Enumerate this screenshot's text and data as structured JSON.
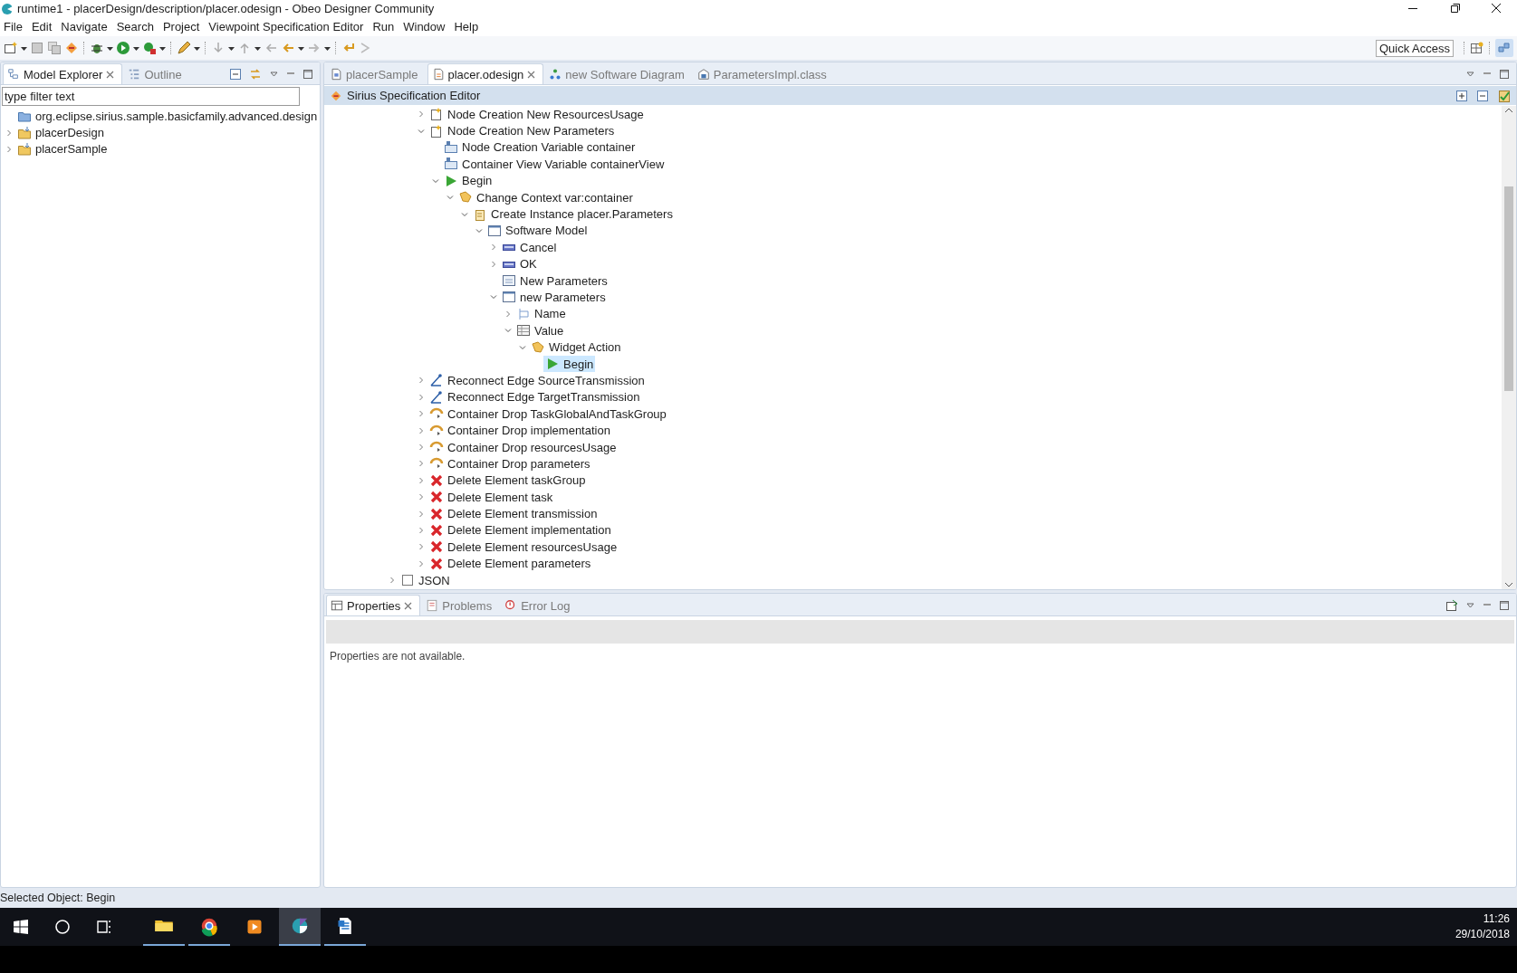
{
  "window": {
    "title": "runtime1 - placerDesign/description/placer.odesign - Obeo Designer Community"
  },
  "menu": [
    "File",
    "Edit",
    "Navigate",
    "Search",
    "Project",
    "Viewpoint Specification Editor",
    "Run",
    "Window",
    "Help"
  ],
  "toolbar": {
    "quick_access": "Quick Access"
  },
  "explorer": {
    "tabs": [
      {
        "label": "Model Explorer",
        "kind": "explorer",
        "selected": true
      },
      {
        "label": "Outline",
        "kind": "outline",
        "selected": false
      }
    ],
    "filter": {
      "placeholder": "type filter text"
    },
    "items": [
      {
        "label": "org.eclipse.sirius.sample.basicfamily.advanced.design",
        "kind": "folder",
        "selected": false
      },
      {
        "label": "placerDesign",
        "kind": "project",
        "expanded": false,
        "selected": false
      },
      {
        "label": "placerSample",
        "kind": "project",
        "expanded": false,
        "selected": false
      }
    ]
  },
  "editor": {
    "tabs": [
      {
        "label": "placerSample",
        "kind": "diagram",
        "selected": false
      },
      {
        "label": "placer.odesign",
        "kind": "odesign",
        "selected": true
      },
      {
        "label": "new Software Diagram",
        "kind": "tree-diagram",
        "selected": false
      },
      {
        "label": "ParametersImpl.class",
        "kind": "class",
        "selected": false
      }
    ],
    "header": "Sirius Specification Editor",
    "tree": {
      "items": [
        {
          "label": "Node Creation New ResourcesUsage",
          "kind": "node-creation",
          "expanded": false,
          "selected": false
        },
        {
          "label": "Node Creation New Parameters",
          "kind": "node-creation",
          "expanded": true,
          "selected": false,
          "children": [
            {
              "label": "Node Creation Variable container",
              "kind": "variable",
              "selected": false
            },
            {
              "label": "Container View Variable containerView",
              "kind": "variable",
              "selected": false
            },
            {
              "label": "Begin",
              "kind": "begin",
              "expanded": true,
              "selected": false,
              "children": [
                {
                  "label": "Change Context var:container",
                  "kind": "change-context",
                  "expanded": true,
                  "selected": false,
                  "children": [
                    {
                      "label": "Create Instance placer.Parameters",
                      "kind": "create-instance",
                      "expanded": true,
                      "selected": false,
                      "children": [
                        {
                          "label": "Software Model",
                          "kind": "page",
                          "expanded": true,
                          "selected": false,
                          "children": [
                            {
                              "label": "Cancel",
                              "kind": "button",
                              "expanded": false,
                              "selected": false
                            },
                            {
                              "label": "OK",
                              "kind": "button",
                              "expanded": false,
                              "selected": false
                            },
                            {
                              "label": "New Parameters",
                              "kind": "form",
                              "selected": false
                            },
                            {
                              "label": "new Parameters",
                              "kind": "page",
                              "expanded": true,
                              "selected": false,
                              "children": [
                                {
                                  "label": "Name",
                                  "kind": "label",
                                  "expanded": false,
                                  "selected": false
                                },
                                {
                                  "label": "Value",
                                  "kind": "table",
                                  "expanded": true,
                                  "selected": false,
                                  "children": [
                                    {
                                      "label": "Widget Action",
                                      "kind": "change-context",
                                      "expanded": true,
                                      "selected": false,
                                      "children": [
                                        {
                                          "label": "Begin",
                                          "kind": "begin",
                                          "selected": true
                                        }
                                      ]
                                    }
                                  ]
                                }
                              ]
                            }
                          ]
                        }
                      ]
                    }
                  ]
                }
              ]
            }
          ]
        },
        {
          "label": "Reconnect Edge SourceTransmission",
          "kind": "reconnect",
          "expanded": false,
          "selected": false
        },
        {
          "label": "Reconnect Edge TargetTransmission",
          "kind": "reconnect",
          "expanded": false,
          "selected": false
        },
        {
          "label": "Container Drop TaskGlobalAndTaskGroup",
          "kind": "drop",
          "expanded": false,
          "selected": false
        },
        {
          "label": "Container Drop implementation",
          "kind": "drop",
          "expanded": false,
          "selected": false
        },
        {
          "label": "Container Drop resourcesUsage",
          "kind": "drop",
          "expanded": false,
          "selected": false
        },
        {
          "label": "Container Drop parameters",
          "kind": "drop",
          "expanded": false,
          "selected": false
        },
        {
          "label": "Delete Element taskGroup",
          "kind": "delete",
          "expanded": false,
          "selected": false
        },
        {
          "label": "Delete Element task",
          "kind": "delete",
          "expanded": false,
          "selected": false
        },
        {
          "label": "Delete Element transmission",
          "kind": "delete",
          "expanded": false,
          "selected": false
        },
        {
          "label": "Delete Element implementation",
          "kind": "delete",
          "expanded": false,
          "selected": false
        },
        {
          "label": "Delete Element resourcesUsage",
          "kind": "delete",
          "expanded": false,
          "selected": false
        },
        {
          "label": "Delete Element parameters",
          "kind": "delete",
          "expanded": false,
          "selected": false
        }
      ],
      "outer_items": [
        {
          "label": "JSON",
          "kind": "group",
          "expanded": false,
          "selected": false
        }
      ]
    }
  },
  "properties": {
    "tabs": [
      {
        "label": "Properties",
        "kind": "properties",
        "selected": true
      },
      {
        "label": "Problems",
        "kind": "problems",
        "selected": false
      },
      {
        "label": "Error Log",
        "kind": "error-log",
        "selected": false
      }
    ],
    "message": "Properties are not available."
  },
  "status_bar": "Selected Object: Begin",
  "taskbar": {
    "apps": [
      {
        "kind": "files",
        "running": true,
        "active": false
      },
      {
        "kind": "browser",
        "running": true,
        "active": false
      },
      {
        "kind": "media",
        "running": false,
        "active": false
      },
      {
        "kind": "designer",
        "running": true,
        "active": true
      },
      {
        "kind": "document",
        "running": true,
        "active": false
      }
    ],
    "time": "11:26",
    "date": "29/10/2018"
  }
}
